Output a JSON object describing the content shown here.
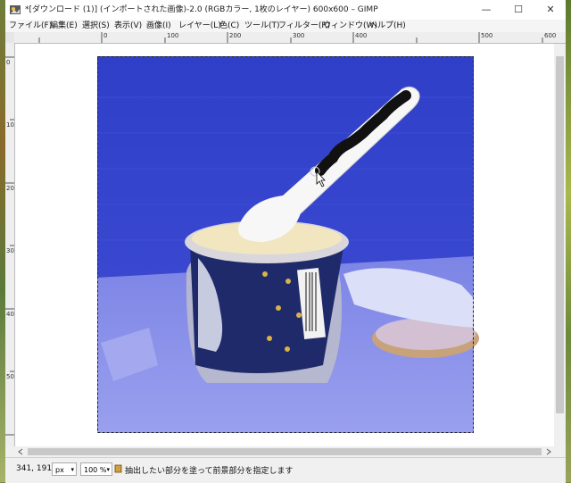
{
  "window": {
    "title": "*[ダウンロード (1)] (インポートされた画像)-2.0 (RGBカラー, 1枚のレイヤー) 600x600 – GIMP",
    "minimize_glyph": "—",
    "maximize_glyph": "☐",
    "close_glyph": "✕"
  },
  "menu": {
    "items": [
      "ファイル(F)",
      "編集(E)",
      "選択(S)",
      "表示(V)",
      "画像(I)",
      "レイヤー(L)",
      "色(C)",
      "ツール(T)",
      "フィルター(R)",
      "ウィンドウ(W)",
      "ヘルプ(H)"
    ]
  },
  "ruler": {
    "top_labels": [
      "0",
      "100",
      "200",
      "300",
      "400",
      "500",
      "600"
    ],
    "left_labels": [
      "0",
      "100",
      "200",
      "300",
      "400",
      "500"
    ]
  },
  "status": {
    "coords": "341, 191",
    "unit": "px",
    "zoom": "100 %",
    "message": "抽出したい部分を塗って前景部分を指定します"
  },
  "colors": {
    "mask_blue": "#3b45d8",
    "selection_border": "#222222"
  }
}
